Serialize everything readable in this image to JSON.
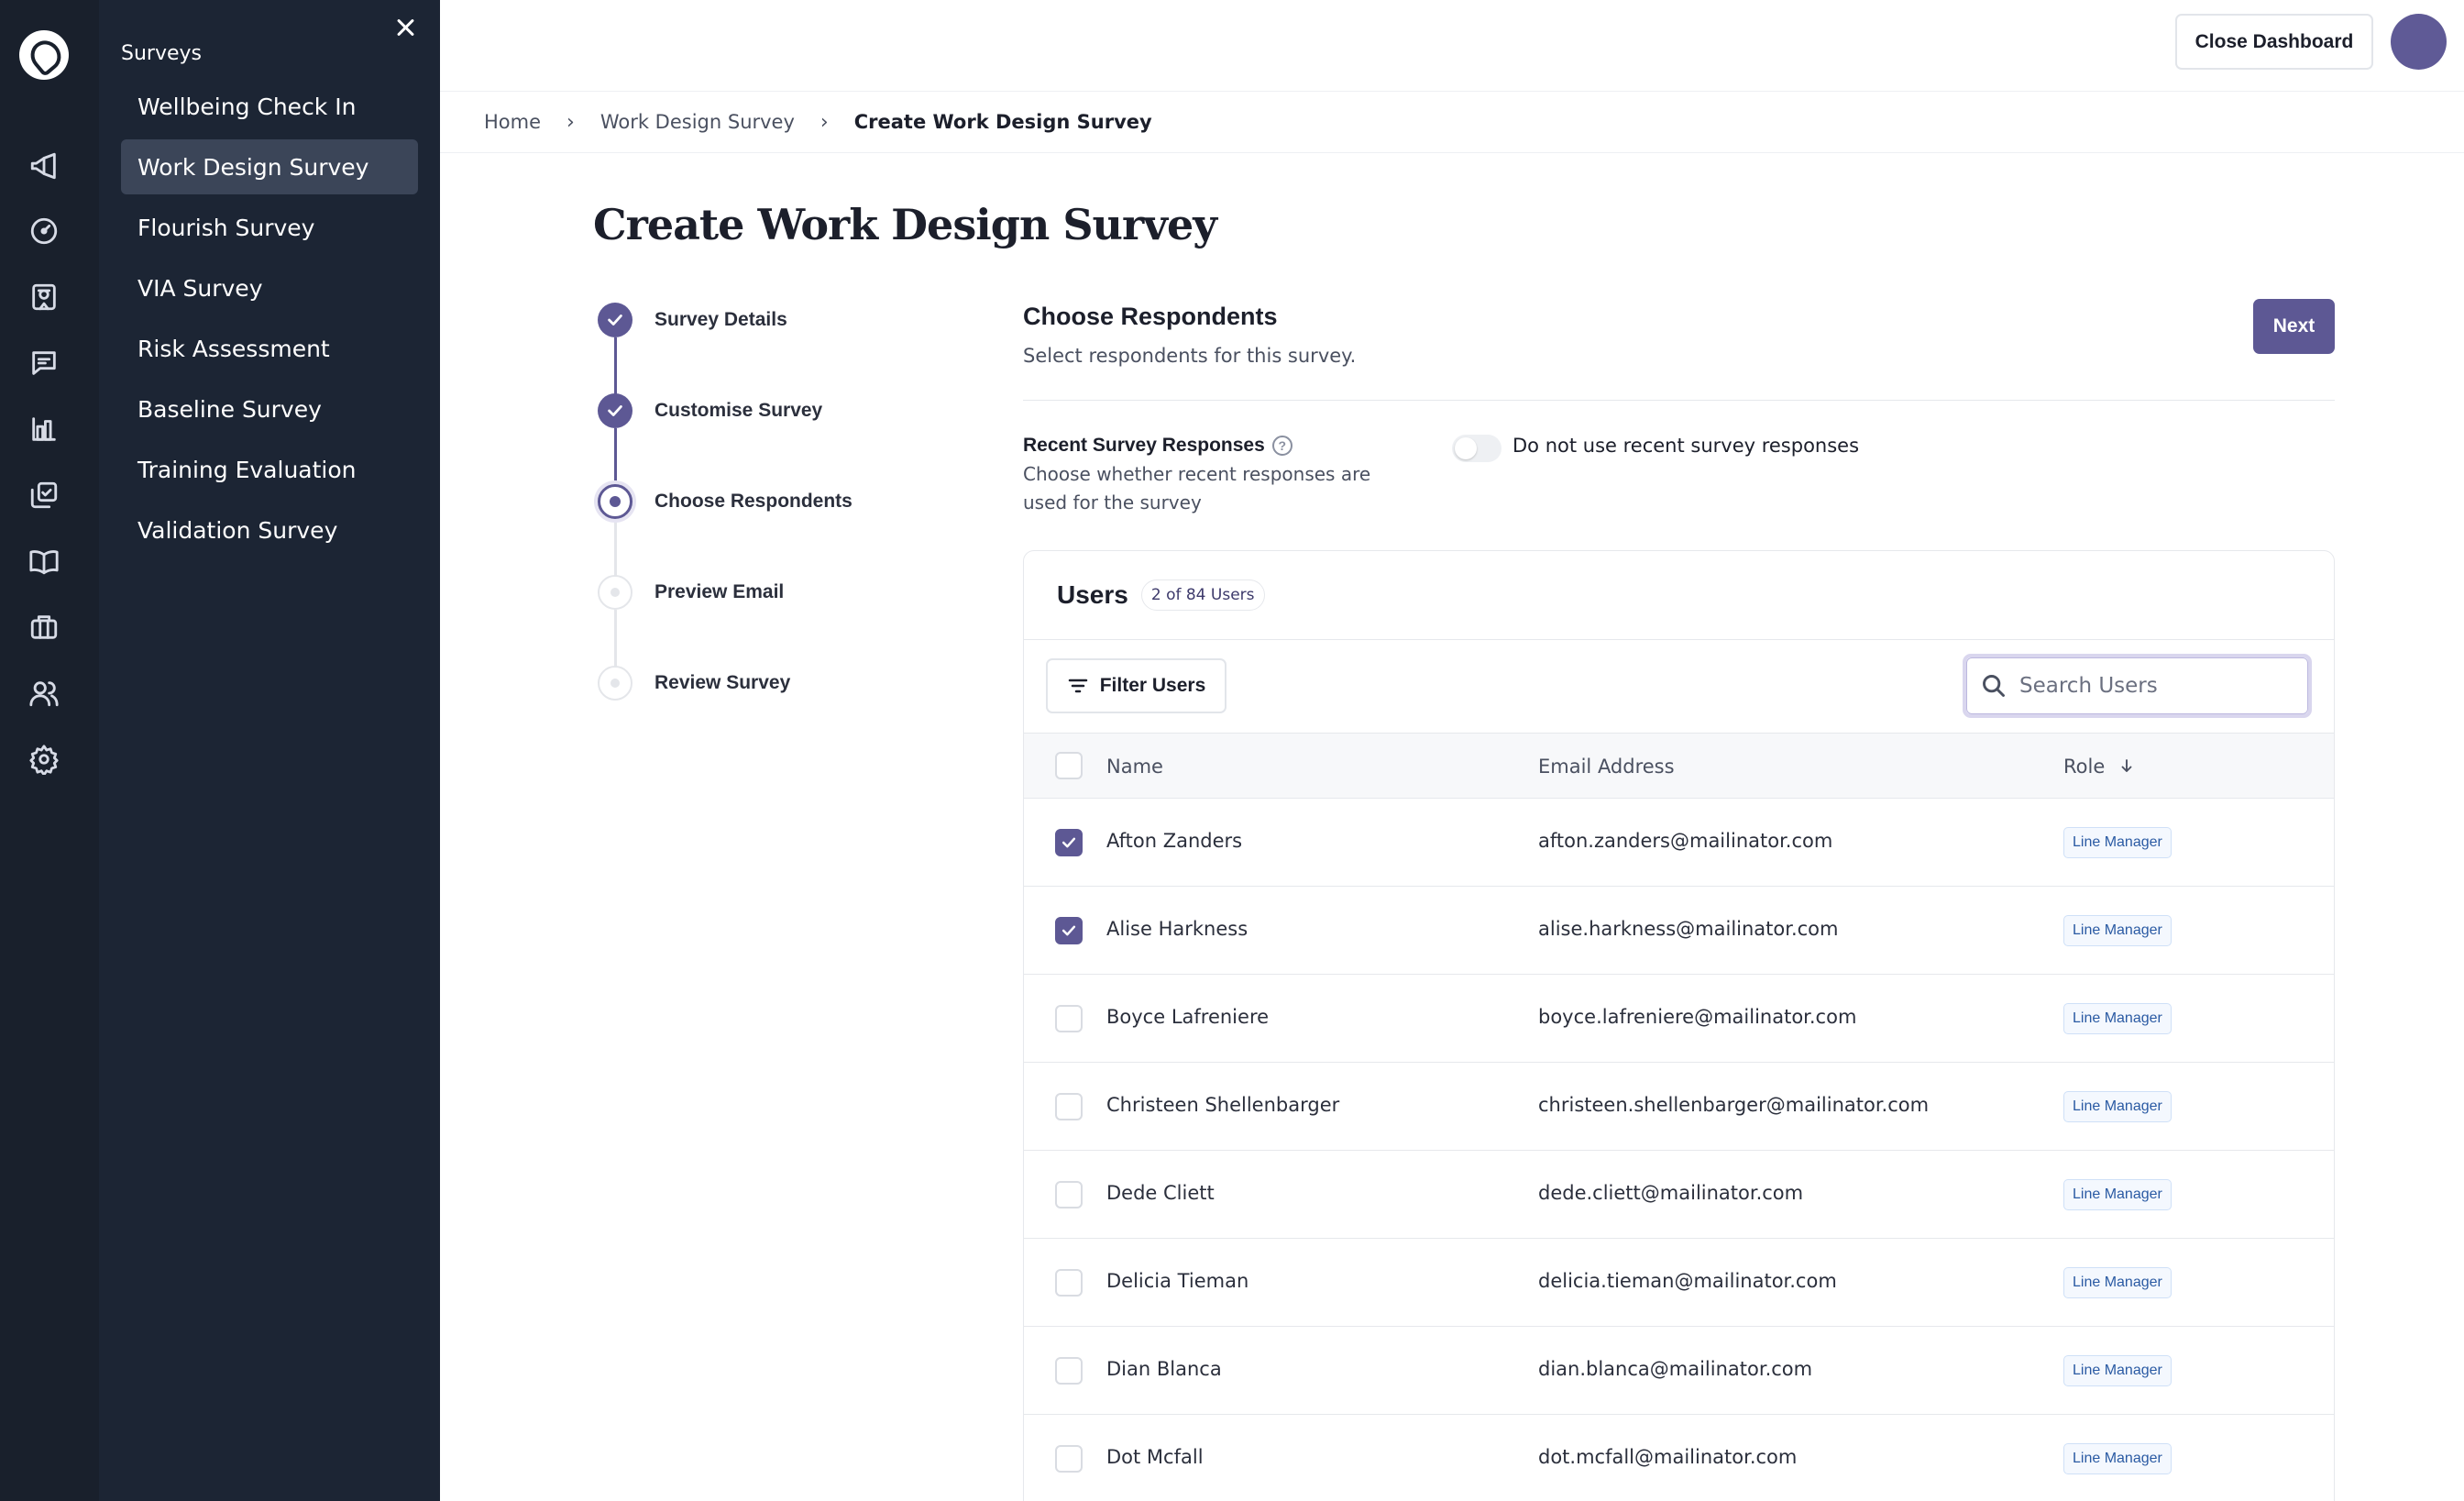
{
  "sidebar": {
    "section_title": "Surveys",
    "items": [
      {
        "label": "Wellbeing Check In",
        "active": false
      },
      {
        "label": "Work Design Survey",
        "active": true
      },
      {
        "label": "Flourish Survey",
        "active": false
      },
      {
        "label": "VIA Survey",
        "active": false
      },
      {
        "label": "Risk Assessment",
        "active": false
      },
      {
        "label": "Baseline Survey",
        "active": false
      },
      {
        "label": "Training Evaluation",
        "active": false
      },
      {
        "label": "Validation Survey",
        "active": false
      }
    ],
    "rail_icons": [
      "megaphone-icon",
      "gauge-icon",
      "certificate-icon",
      "chat-icon",
      "bar-chart-icon",
      "checklist-icon",
      "book-icon",
      "briefcase-icon",
      "users-icon",
      "settings-icon"
    ]
  },
  "header": {
    "close_dashboard_label": "Close Dashboard"
  },
  "breadcrumb": [
    "Home",
    "Work Design Survey",
    "Create Work Design Survey"
  ],
  "page": {
    "title": "Create Work Design Survey"
  },
  "stepper": [
    {
      "label": "Survey Details",
      "state": "done"
    },
    {
      "label": "Customise Survey",
      "state": "done"
    },
    {
      "label": "Choose Respondents",
      "state": "current"
    },
    {
      "label": "Preview Email",
      "state": "todo"
    },
    {
      "label": "Review Survey",
      "state": "todo"
    }
  ],
  "section": {
    "title": "Choose Respondents",
    "subtitle": "Select respondents for this survey.",
    "next_label": "Next"
  },
  "recent": {
    "label": "Recent Survey Responses",
    "description": "Choose whether recent responses are used for the survey",
    "toggle_label": "Do not use recent survey responses",
    "toggle_on": false
  },
  "users": {
    "title": "Users",
    "count_badge": "2 of 84 Users",
    "filter_label": "Filter Users",
    "search_placeholder": "Search Users",
    "columns": {
      "name": "Name",
      "email": "Email Address",
      "role": "Role"
    },
    "rows": [
      {
        "name": "Afton Zanders",
        "email": "afton.zanders@mailinator.com",
        "role": "Line Manager",
        "checked": true
      },
      {
        "name": "Alise Harkness",
        "email": "alise.harkness@mailinator.com",
        "role": "Line Manager",
        "checked": true
      },
      {
        "name": "Boyce Lafreniere",
        "email": "boyce.lafreniere@mailinator.com",
        "role": "Line Manager",
        "checked": false
      },
      {
        "name": "Christeen Shellenbarger",
        "email": "christeen.shellenbarger@mailinator.com",
        "role": "Line Manager",
        "checked": false
      },
      {
        "name": "Dede Cliett",
        "email": "dede.cliett@mailinator.com",
        "role": "Line Manager",
        "checked": false
      },
      {
        "name": "Delicia Tieman",
        "email": "delicia.tieman@mailinator.com",
        "role": "Line Manager",
        "checked": false
      },
      {
        "name": "Dian Blanca",
        "email": "dian.blanca@mailinator.com",
        "role": "Line Manager",
        "checked": false
      },
      {
        "name": "Dot Mcfall",
        "email": "dot.mcfall@mailinator.com",
        "role": "Line Manager",
        "checked": false
      }
    ]
  },
  "colors": {
    "accent": "#5d5894",
    "rail_bg": "#19202c",
    "nav_bg": "#1c2534",
    "badge_text": "#2a5aa3"
  }
}
